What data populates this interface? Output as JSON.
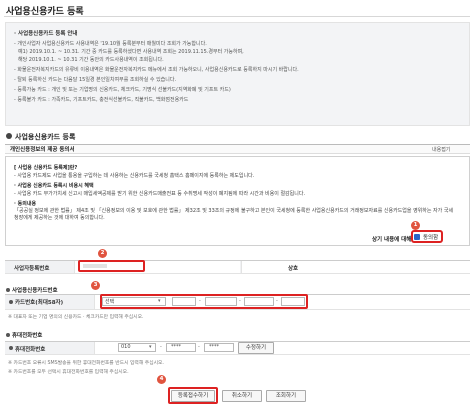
{
  "page": {
    "title": "사업용신용카드 등록"
  },
  "guide": {
    "title": "· 사업용신용카드 등록 안내",
    "lines": [
      "- 개인사업자 사업용신용카드 사용내역은 '19.10월 등록분부터 매월미다 조회가 가능합니다.",
      "예1) 2019.10.1. ~ 10.31. 기간 중 카드를 등록하셨다면 사용내역 조회는 2019.11.15.경부터 가능하며,",
      "해당 2019.10.1. ~ 10.31 기간 동안의 카드사용내역이 조회됩니다.",
      "- 화물운전자복지카드의 유류비 이용내역은 화물운전자복지카드 메뉴에서 조회 가능하오니, 사업용신용카드로 등록하지 마시기 바랍니다.",
      "- 탈퇴 등록하신 카드는 다음달 15일경 본인일치여부를 조회하실 수 있습니다.",
      "- 등록가능 카드 : 개인 및 또는 기업명의 신용카드, 체크카드, 기명식 선불카드(지역화폐 및 기프트 카드)",
      "- 등록불가 카드 : 가족카드, 기프트카드, 충전식선불카드, 직불카드, 백화점전용카드"
    ]
  },
  "section": {
    "title": "사업용신용카드 등록"
  },
  "consent": {
    "header": "개인신용정보의 제공 동의서",
    "collapse_label": "내용접기",
    "items": [
      "[ 사업용 신용카드 등록제]란?",
      "- 사업용 카드제도 사업을 통용을 구입하는 데 사용하는 신용카드를 국세청 홈택스 홈페이지에 등록하는 제도입니다.",
      "· 사업용 신용카드 등록시 비용시 혜택",
      "- 사업용 카드 부가가치세 신고시 매입세액공제를 받기 위한 신용카드매출전표 등 수취명세 작성이 폐지됨에 따라 시간과 비용이 절감됩니다.",
      "· 동의내용",
      "「공공실 정보에 관한 법률」 제4조 및 「신용정보의 이용 및 보호에 관한 법률」 제32조 및 33조의 규정에 불구하고 본인이 국세청에 등록한 사업용신용카드의 거래정보자료를 신용카드업을 영위하는 자가 국세청장에게 제공하는 것에 대하여 동의합니다."
    ],
    "agree_text": "상기 내용에 대해",
    "agree_label": "동의함"
  },
  "business": {
    "reg_no_label": "사업자등록번호",
    "name_label": "상호"
  },
  "card": {
    "heading": "사업용신용카드번호",
    "number_label": "카드번호(최대58자)",
    "select_value": "선택",
    "note": "※ 대표자 또는 기업 명의의 신용카드 · 체크카드만 입력해 주십시오."
  },
  "phone": {
    "heading": "휴대전화번호",
    "label": "휴대전화번호",
    "prefix": "010",
    "middle": "****",
    "last": "****",
    "edit_button": "수정하기",
    "notes": [
      "※ 카드번호 오류시 SMS발송을 위한 휴대전화번호를 반드시 입력해 주십시오.",
      "※ 카드번호를 모두 선택시 휴대전화번호를 입력해 주십시오."
    ]
  },
  "actions": {
    "register": "등록접수하기",
    "cancel": "취소하기",
    "lookup": "조회하기"
  },
  "steps": [
    "1",
    "2",
    "3",
    "4"
  ],
  "colors": {
    "highlight": "#dd2222",
    "badge": "#e0543f",
    "checkbox": "#2a66c9"
  }
}
